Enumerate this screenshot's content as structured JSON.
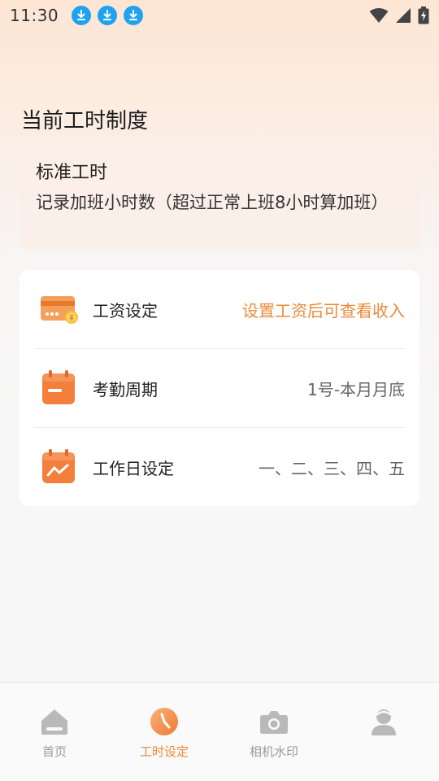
{
  "status_bar": {
    "time": "11:30",
    "icons": [
      "download-icon",
      "download-icon",
      "download-icon",
      "wifi-icon",
      "cellular-signal-icon",
      "battery-charging-icon"
    ]
  },
  "page": {
    "title": "当前工时制度"
  },
  "work_system": {
    "name": "标准工时",
    "description": "记录加班小时数（超过正常上班8小时算加班）"
  },
  "settings": {
    "rows": [
      {
        "icon": "salary-card-icon",
        "label": "工资设定",
        "value": "设置工资后可查看收入"
      },
      {
        "icon": "calendar-icon",
        "label": "考勤周期",
        "value": "1号-本月月底"
      },
      {
        "icon": "calendar-chart-icon",
        "label": "工作日设定",
        "value": "一、二、三、四、五"
      }
    ]
  },
  "bottom_nav": {
    "items": [
      {
        "icon": "home-icon",
        "label": "首页",
        "active": false
      },
      {
        "icon": "clock-icon",
        "label": "工时设定",
        "active": true
      },
      {
        "icon": "camera-icon",
        "label": "相机水印",
        "active": false
      },
      {
        "icon": "profile-icon",
        "label": "",
        "active": false
      }
    ]
  },
  "colors": {
    "accent": "#ec8a3a",
    "icon_orange": "#f47e3c",
    "download_blue": "#1fa3f0",
    "nav_inactive": "#9a9a9a",
    "card_bg": "#ffffff"
  }
}
